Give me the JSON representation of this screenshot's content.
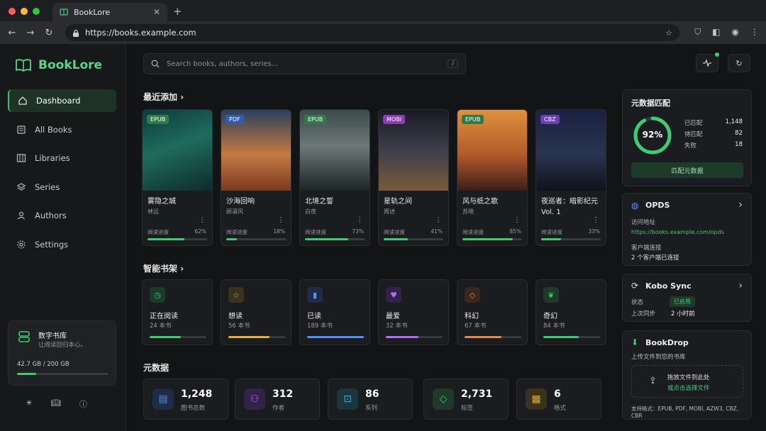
{
  "browser": {
    "tab_title": "BookLore",
    "tab_close": "✕",
    "new_tab": "+",
    "url": "https://books.example.com"
  },
  "sidebar": {
    "brand": "BookLore",
    "items": [
      {
        "label": "Dashboard",
        "icon": "home-icon",
        "active": true
      },
      {
        "label": "All Books",
        "icon": "book-list-icon"
      },
      {
        "label": "Libraries",
        "icon": "library-icon"
      },
      {
        "label": "Series",
        "icon": "layers-icon"
      },
      {
        "label": "Authors",
        "icon": "user-icon"
      },
      {
        "label": "Settings",
        "icon": "gear-icon"
      }
    ],
    "library": {
      "title": "数字书库",
      "subtitle": "让阅读回归本心。",
      "size": "42.7 GB / 200 GB",
      "fraction": 0.2135
    }
  },
  "search": {
    "placeholder": "Search books, authors, series...",
    "shortcut": "/"
  },
  "recent": {
    "title": "最近添加",
    "books": [
      {
        "format": "EPUB",
        "title": "雾隐之城",
        "author": "林远",
        "progress_label": "阅读进度",
        "pct": "62%",
        "value": 0.62,
        "fmt_color": "#2f7a4a"
      },
      {
        "format": "PDF",
        "title": "沙海回响",
        "author": "顾凛风",
        "progress_label": "阅读进度",
        "pct": "18%",
        "value": 0.18,
        "fmt_color": "#2f5fa8"
      },
      {
        "format": "EPUB",
        "title": "北境之誓",
        "author": "白夜",
        "progress_label": "阅读进度",
        "pct": "73%",
        "value": 0.73,
        "fmt_color": "#2f7a4a"
      },
      {
        "format": "MOBI",
        "title": "星轨之间",
        "author": "周述",
        "progress_label": "阅读进度",
        "pct": "41%",
        "value": 0.41,
        "fmt_color": "#8a3fb0"
      },
      {
        "format": "EPUB",
        "title": "风与纸之歌",
        "author": "苏晓",
        "progress_label": "阅读进度",
        "pct": "85%",
        "value": 0.85,
        "fmt_color": "#2f7a4a"
      },
      {
        "format": "CBZ",
        "title": "夜巡者：暗影纪元 Vol. 1",
        "author": "",
        "progress_label": "阅读进度",
        "pct": "33%",
        "value": 0.33,
        "fmt_color": "#6a3fb0"
      }
    ]
  },
  "shelves": {
    "title": "智能书架",
    "items": [
      {
        "name": "正在阅读",
        "count": "24 本书",
        "icon": "clock-icon",
        "color": "#3ecb74",
        "bg": "#1f3a2a",
        "fill": 0.55
      },
      {
        "name": "想读",
        "count": "56 本书",
        "icon": "star-icon",
        "color": "#e0b23a",
        "bg": "#3a321c",
        "fill": 0.72
      },
      {
        "name": "已读",
        "count": "189 本书",
        "icon": "bookmark-icon",
        "color": "#5b8ef0",
        "bg": "#1f2c47",
        "fill": 1.0
      },
      {
        "name": "最爱",
        "count": "32 本书",
        "icon": "heart-icon",
        "color": "#b070f0",
        "bg": "#33234a",
        "fill": 0.58
      },
      {
        "name": "科幻",
        "count": "67 本书",
        "icon": "tag-icon",
        "color": "#e08a50",
        "bg": "#3a271c",
        "fill": 0.65
      },
      {
        "name": "奇幻",
        "count": "84 本书",
        "icon": "leaf-icon",
        "color": "#3ecb74",
        "bg": "#1f3a2a",
        "fill": 0.62
      }
    ]
  },
  "metadata": {
    "title": "元数据",
    "stats": [
      {
        "value": "1,248",
        "label": "图书总数",
        "icon": "open-book-icon",
        "color": "#5b8ef0",
        "bg": "#1f2c47"
      },
      {
        "value": "312",
        "label": "作者",
        "icon": "users-icon",
        "color": "#b070f0",
        "bg": "#33234a"
      },
      {
        "value": "86",
        "label": "系列",
        "icon": "inbox-icon",
        "color": "#3ab0d0",
        "bg": "#1c3640"
      },
      {
        "value": "2,731",
        "label": "标签",
        "icon": "tag-icon",
        "color": "#3ecb74",
        "bg": "#1f3a2a"
      },
      {
        "value": "6",
        "label": "格式",
        "icon": "file-icon",
        "color": "#e0b23a",
        "bg": "#3a321c"
      }
    ]
  },
  "match": {
    "title": "元数据匹配",
    "percent": "92%",
    "value": 0.92,
    "rows": [
      {
        "k": "已匹配",
        "v": "1,148"
      },
      {
        "k": "待匹配",
        "v": "82"
      },
      {
        "k": "失败",
        "v": "18"
      }
    ],
    "button": "匹配元数据"
  },
  "opds": {
    "title": "OPDS",
    "addr_label": "访问地址",
    "addr": "https://books.example.com/opds",
    "conn_label": "客户端连接",
    "conn": "2 个客户端已连接"
  },
  "kobo": {
    "title": "Kobo Sync",
    "status_label": "状态",
    "status": "已启用",
    "last_label": "上次同步",
    "last": "2 小时前"
  },
  "bookdrop": {
    "title": "BookDrop",
    "subtitle": "上传文件到您的书库",
    "drop1": "拖放文件到此处",
    "drop2": "或点击选择文件",
    "formats": "支持格式：EPUB, PDF, MOBI, AZW3, CBZ, CBR"
  },
  "colors": {
    "accent": "#3ecb74",
    "brand": "#5fd18a"
  }
}
